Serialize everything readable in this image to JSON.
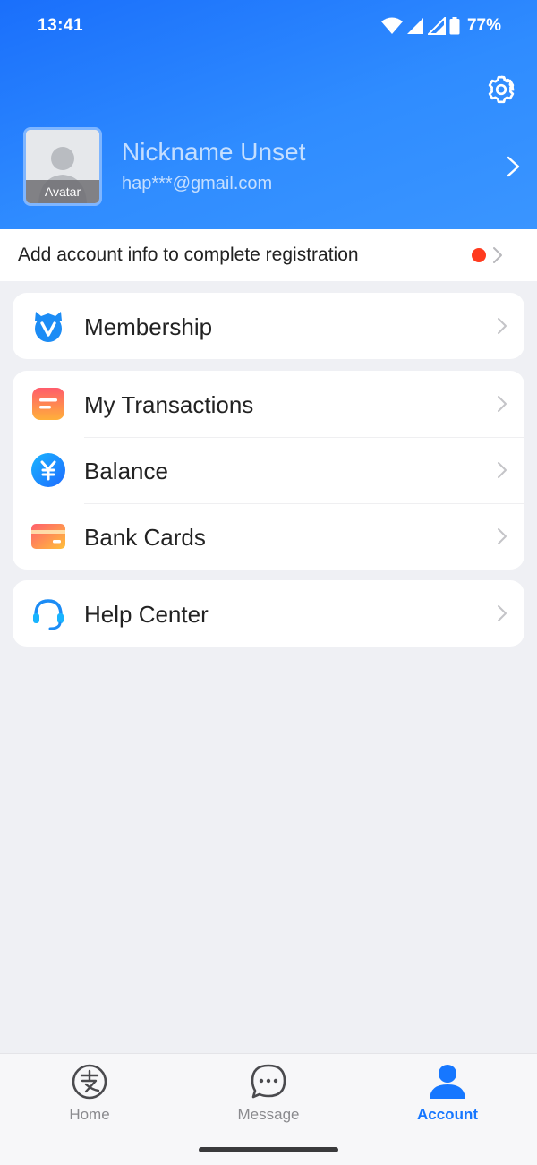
{
  "status_bar": {
    "time": "13:41",
    "battery_percent": "77%",
    "icons": [
      "wifi-icon",
      "signal-icon",
      "signal-icon",
      "battery-icon"
    ]
  },
  "header": {
    "settings_icon": "gear-icon"
  },
  "profile": {
    "avatar_label": "Avatar",
    "nickname": "Nickname Unset",
    "email": "hap***@gmail.com"
  },
  "registration": {
    "text": "Add account info to complete registration",
    "dot_color": "#ff3b1f"
  },
  "menu_groups": [
    {
      "items": [
        {
          "label": "Membership",
          "icon": "membership-icon"
        }
      ]
    },
    {
      "items": [
        {
          "label": "My Transactions",
          "icon": "transactions-icon"
        },
        {
          "label": "Balance",
          "icon": "balance-yen-icon"
        },
        {
          "label": "Bank Cards",
          "icon": "bank-card-icon"
        }
      ]
    },
    {
      "items": [
        {
          "label": "Help Center",
          "icon": "headset-icon"
        }
      ]
    }
  ],
  "bottom_nav": {
    "items": [
      {
        "label": "Home",
        "icon": "home-zhi-icon",
        "active": false
      },
      {
        "label": "Message",
        "icon": "chat-bubble-icon",
        "active": false
      },
      {
        "label": "Account",
        "icon": "person-icon",
        "active": true
      }
    ]
  },
  "colors": {
    "header_blue": "#1a6ffb",
    "accent": "#1677ff",
    "background": "#eff0f4"
  }
}
